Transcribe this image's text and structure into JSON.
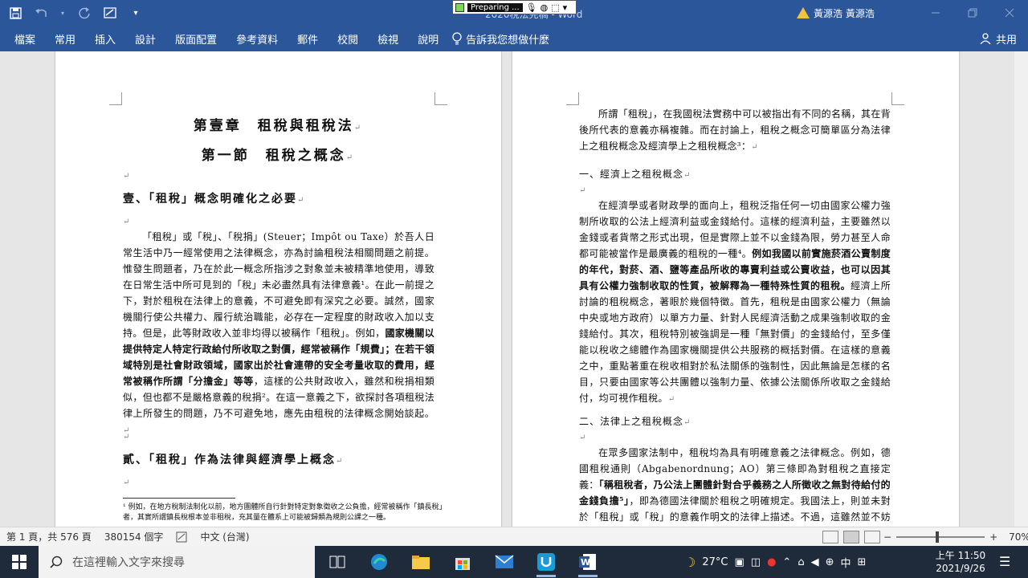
{
  "titlebar": {
    "doc_title": "2020稅法完稿 - Word",
    "recording_label": "Preparing ...",
    "user_name": "黃源浩 黃源浩",
    "icons": [
      "save-icon",
      "undo-icon",
      "redo-icon",
      "format-icon",
      "customize-icon",
      "warning-icon",
      "minimize-icon",
      "restore-icon",
      "close-icon"
    ]
  },
  "ribbon": {
    "tabs": [
      "檔案",
      "常用",
      "插入",
      "設計",
      "版面配置",
      "參考資料",
      "郵件",
      "校閱",
      "檢視",
      "說明"
    ],
    "tell_me": "告訴我您想做什麼",
    "share": "共用"
  },
  "page1": {
    "chapter": "第壹章　租稅與租稅法",
    "section": "第一節　租稅之概念",
    "heading1": "壹、「租稅」概念明確化之必要",
    "p1": [
      {
        "t": "「租稅」或「稅」、「稅捐」(Steuer；Impôt ou Taxe）於吾人日常生活中乃一經常使用之法律概念，亦為討論租稅法相關問題之前提。惟發生問題者，乃在於此一概念所指涉之對象並未被精準地使用，導致在日常生活中所可見到的「稅」未必盡然具有法律意義¹。在此一前提之下，對於租稅在法律上的意義，不可避免即有深究之必要。誠然，國家機關行使公共權力、履行統治職能，必存在一定程度的財政收入加以支持。但是，此等財政收入並非均得以被稱作「租稅」。例如，",
        "b": false
      },
      {
        "t": "國家機關以提供特定人特定行政給付所收取之對價，經常被稱作「規費」；在若干領域特別是社會財政領域，國家出於社會連帶的安全考量收取的費用，經常被稱作所謂「分擔金」等等",
        "b": true
      },
      {
        "t": "，這樣的公共財政收入，雖然和稅捐相類似，但也都不是嚴格意義的稅捐²。在這一意義之下，欲探討各項租稅法律上所發生的問題，乃不可避免地，應先由租稅的法律概念開始談起。",
        "b": false
      }
    ],
    "heading2": "貳、「租稅」作為法律與經濟學上概念",
    "footnote": "¹ 例如，在地方稅制法制化以前，地方團體所自行針對特定對象徵收之公負擔，經常被稱作「鎮長稅」者，其實所謂鎮長稅根本並非租稅，充其量在體系上可能被歸類為規則公課之一種。"
  },
  "page2": {
    "p1": "所謂「租稅」，在我國稅法實務中可以被指出有不同的名稱，其在背後所代表的意義亦稱複雜。而在討論上，租稅之概念可簡單區分為法律上之租稅概念及經濟學上之租稅概念³：",
    "sub1": "一、經濟上之租稅概念",
    "p2": [
      {
        "t": "在經濟學或者財政學的面向上，租稅泛指任何一切由國家公權力強制所收取的公法上經濟利益或金錢給付。這樣的經濟利益，主要雖然以金錢或者貨幣之形式出現，但是實際上並不以金錢為限，勞力甚至人命都可能被當作是最廣義的租稅的一種⁴。",
        "b": false
      },
      {
        "t": "例如我國以前實施菸酒公賣制度的年代，對菸、酒、鹽等產品所收的專賣利益或公賣收益，也可以因其具有公權力強制收取的性質，被解釋為一種特殊性質的租稅。",
        "b": true
      },
      {
        "t": "經濟上所討論的租稅概念，著眼於幾個特徵。首先，租稅是由國家公權力（無論中央或地方政府）以單方力量、針對人民經濟活動之成果強制收取的金錢給付。其次，租稅特別被強調是一種「無對價」的金錢給付，至多僅能以稅收之總體作為國家機關提供公共服務的概括對價。在這樣的意義之中，重點著重在稅收相對於私法關係的強制性，因此無論是怎樣的名目，只要由國家等公共團體以強制力量、依據公法關係所收取之金錢給付，均可視作租稅。",
        "b": false
      }
    ],
    "sub2": "二、法律上之租稅概念",
    "p3": [
      {
        "t": "在眾多國家法制中，租稅均為具有明確意義之法律概念。例如，德國租稅通則（Abgabenordnung；AO）第三條即為對租稅之直接定義：",
        "b": false
      },
      {
        "t": "「稱租稅者，乃公法上團體針對合乎義務之人所徵收之無對待給付的金錢負擔⁵」",
        "b": true
      },
      {
        "t": "，即為德國法律關於租稅之明確規定。我國法上，則並未對於「租稅」或「稅」的意義作明文的法律上描述。不過，這雖然並不妨礙租稅此一概念在實務生活或稅務實務之運用，但在問題的探討上仍有必要。",
        "b": false
      }
    ]
  },
  "status": {
    "page": "第 1 頁，共 576 頁",
    "words": "380154 個字",
    "lang": "中文 (台灣)",
    "zoom": "70%",
    "zoom_level": 0.46
  },
  "taskbar": {
    "search_placeholder": "在這裡輸入文字來搜尋",
    "weather": "27°C",
    "ime": "中",
    "time": "上午 11:50",
    "date": "2021/9/26"
  }
}
